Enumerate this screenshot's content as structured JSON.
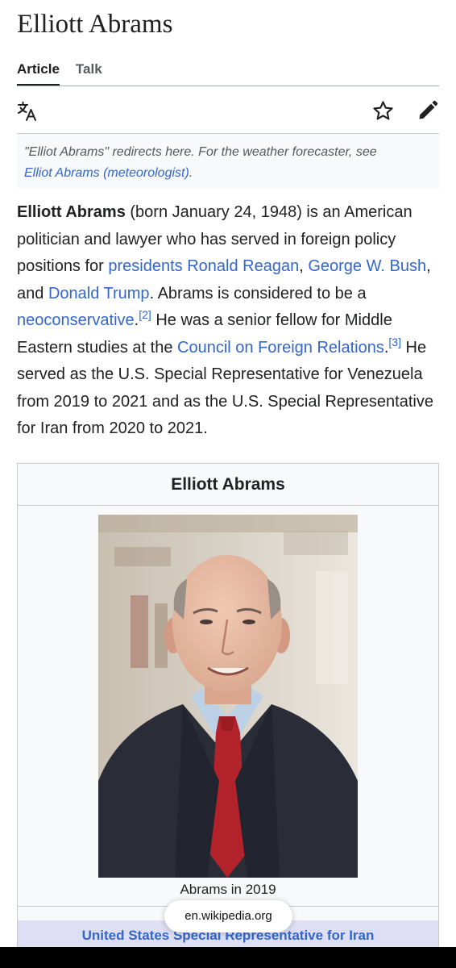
{
  "page": {
    "title": "Elliott Abrams"
  },
  "tabs": [
    {
      "label": "Article",
      "active": true
    },
    {
      "label": "Talk",
      "active": false
    }
  ],
  "toolbar": {
    "icons": [
      "language-icon",
      "star-icon",
      "edit-pencil-icon"
    ]
  },
  "hatnote": {
    "text": "\"Elliot Abrams\" redirects here. For the weather forecaster, see",
    "link": "Elliot Abrams (meteorologist)",
    "suffix": "."
  },
  "lead": {
    "bold_name": "Elliott Abrams",
    "t1": " (born January 24, 1948) is an American politician and lawyer who has served in foreign policy positions for ",
    "link_reagan": "presidents Ronald Reagan",
    "t2": ", ",
    "link_bush": "George W. Bush",
    "t3": ", and ",
    "link_trump": "Donald Trump",
    "t4": ". Abrams is considered to be a ",
    "link_neo": "neoconservative",
    "t5": ".",
    "ref2": "[2]",
    "t6": " He was a senior fellow for Middle Eastern studies at the ",
    "link_cfr": "Council on Foreign Relations",
    "t7": ".",
    "ref3": "[3]",
    "t8": " He served as the U.S. Special Representative for Venezuela from 2019 to 2021 and as the U.S. Special Representative for Iran from 2020 to 2021."
  },
  "infobox": {
    "title": "Elliott Abrams",
    "caption": "Abrams in 2019",
    "section_header": "United States Special Representative for Iran"
  },
  "browser": {
    "url": "en.wikipedia.org"
  },
  "colors": {
    "link": "#3366cc",
    "text": "#202122",
    "band": "#dedff4"
  }
}
